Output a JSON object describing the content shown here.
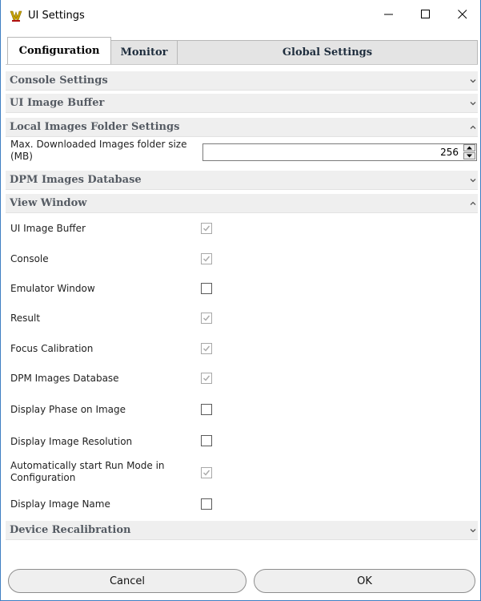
{
  "window": {
    "title": "UI Settings",
    "minimize_icon": "minimize-icon",
    "maximize_icon": "maximize-icon",
    "close_icon": "close-icon"
  },
  "tabs": [
    {
      "label": "Configuration",
      "active": true
    },
    {
      "label": "Monitor",
      "active": false
    },
    {
      "label": "Global Settings",
      "active": false
    }
  ],
  "sections": {
    "console_settings": {
      "label": "Console Settings",
      "expanded": false
    },
    "ui_image_buffer": {
      "label": "UI Image Buffer",
      "expanded": false
    },
    "local_images_folder": {
      "label": "Local Images Folder Settings",
      "expanded": true,
      "max_folder_size_label": "Max. Downloaded Images folder size (MB)",
      "max_folder_size_value": "256"
    },
    "dpm_images_database": {
      "label": "DPM Images Database",
      "expanded": false
    },
    "view_window": {
      "label": "View Window",
      "expanded": true,
      "items": [
        {
          "label": "UI Image Buffer",
          "checked": true
        },
        {
          "label": "Console",
          "checked": true
        },
        {
          "label": "Emulator Window",
          "checked": false
        },
        {
          "label": "Result",
          "checked": true
        },
        {
          "label": "Focus Calibration",
          "checked": true
        },
        {
          "label": "DPM Images Database",
          "checked": true
        },
        {
          "label": "Display Phase on Image",
          "checked": false
        },
        {
          "label": "Display Image Resolution",
          "checked": false
        },
        {
          "label": "Automatically start Run Mode in Configuration",
          "checked": true
        },
        {
          "label": "Display Image Name",
          "checked": false
        }
      ]
    },
    "device_recalibration": {
      "label": "Device Recalibration",
      "expanded": false
    }
  },
  "buttons": {
    "cancel_label": "Cancel",
    "ok_label": "OK"
  },
  "colors": {
    "window_border": "#3f7fc3",
    "section_header_bg": "#efefef",
    "section_header_text": "#555b63",
    "checked_mark": "#a8a8a8",
    "app_icon": "#c9a400"
  }
}
